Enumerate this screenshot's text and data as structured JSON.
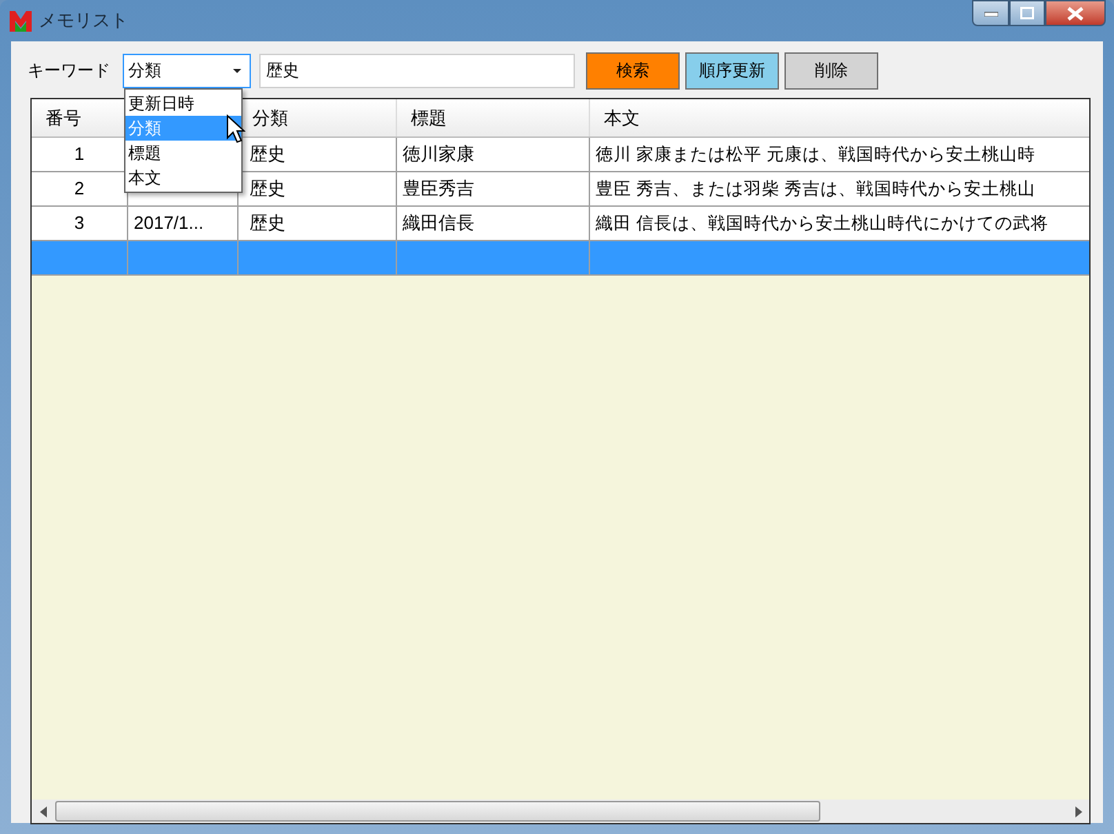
{
  "window": {
    "title": "メモリスト"
  },
  "toolbar": {
    "keyword_label": "キーワード",
    "field_combo": {
      "value": "分類",
      "expanded": true,
      "options": [
        {
          "label": "更新日時",
          "selected": false
        },
        {
          "label": "分類",
          "selected": true
        },
        {
          "label": "標題",
          "selected": false
        },
        {
          "label": "本文",
          "selected": false
        }
      ]
    },
    "search_value": "歴史",
    "buttons": [
      {
        "label": "検索",
        "color": "#ff8000"
      },
      {
        "label": "順序更新",
        "color": "#87ceeb"
      },
      {
        "label": "削除",
        "color": "#d3d3d3"
      }
    ]
  },
  "table": {
    "columns": [
      "番号",
      "",
      "分類",
      "標題",
      "本文"
    ],
    "rows": [
      {
        "cells": [
          "1",
          "",
          "歴史",
          "徳川家康",
          "徳川 家康または松平 元康は、戦国時代から安土桃山時"
        ],
        "selected": false
      },
      {
        "cells": [
          "2",
          "",
          "歴史",
          "豊臣秀吉",
          "豊臣 秀吉、または羽柴 秀吉は、戦国時代から安土桃山"
        ],
        "selected": false
      },
      {
        "cells": [
          "3",
          "2017/1...",
          "歴史",
          "織田信長",
          "織田 信長は、戦国時代から安土桃山時代にかけての武将"
        ],
        "selected": false
      },
      {
        "cells": [
          "",
          "",
          "",
          "",
          ""
        ],
        "selected": true
      }
    ]
  }
}
